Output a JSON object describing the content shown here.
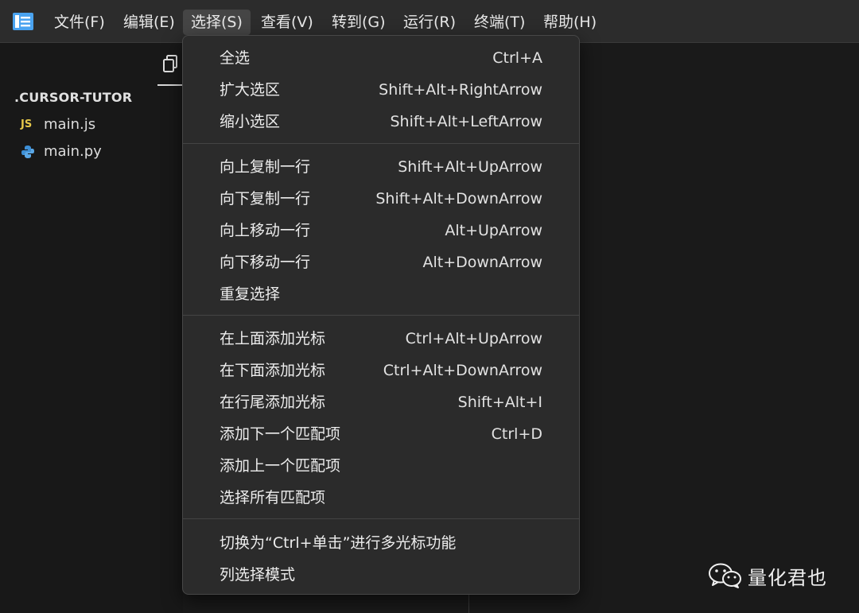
{
  "menubar": {
    "items": [
      {
        "label": "文件(F)"
      },
      {
        "label": "编辑(E)"
      },
      {
        "label": "选择(S)"
      },
      {
        "label": "查看(V)"
      },
      {
        "label": "转到(G)"
      },
      {
        "label": "运行(R)"
      },
      {
        "label": "终端(T)"
      },
      {
        "label": "帮助(H)"
      }
    ],
    "active_index": 2
  },
  "sidebar": {
    "folder_title": ".CURSOR-TUTOR",
    "files": [
      {
        "name": "main.js",
        "icon": "js-file-icon",
        "icon_text": "JS"
      },
      {
        "name": "main.py",
        "icon": "python-file-icon"
      }
    ]
  },
  "dropdown": {
    "items": [
      {
        "label": "全选",
        "shortcut": "Ctrl+A"
      },
      {
        "label": "扩大选区",
        "shortcut": "Shift+Alt+RightArrow"
      },
      {
        "label": "缩小选区",
        "shortcut": "Shift+Alt+LeftArrow"
      },
      {
        "label": "向上复制一行",
        "shortcut": "Shift+Alt+UpArrow"
      },
      {
        "label": "向下复制一行",
        "shortcut": "Shift+Alt+DownArrow"
      },
      {
        "label": "向上移动一行",
        "shortcut": "Alt+UpArrow"
      },
      {
        "label": "向下移动一行",
        "shortcut": "Alt+DownArrow"
      },
      {
        "label": "重复选择",
        "shortcut": ""
      },
      {
        "label": "在上面添加光标",
        "shortcut": "Ctrl+Alt+UpArrow"
      },
      {
        "label": "在下面添加光标",
        "shortcut": "Ctrl+Alt+DownArrow"
      },
      {
        "label": "在行尾添加光标",
        "shortcut": "Shift+Alt+I"
      },
      {
        "label": "添加下一个匹配项",
        "shortcut": "Ctrl+D"
      },
      {
        "label": "添加上一个匹配项",
        "shortcut": ""
      },
      {
        "label": "选择所有匹配项",
        "shortcut": ""
      },
      {
        "label": "切换为“Ctrl+单击”进行多光标功能",
        "shortcut": ""
      },
      {
        "label": "列选择模式",
        "shortcut": ""
      }
    ]
  },
  "watermark": {
    "text": "量化君也",
    "icon": "wechat-icon"
  },
  "colors": {
    "menubar_bg": "#2c2c2c",
    "dropdown_bg": "#2b2b2b",
    "sidebar_bg": "#181818",
    "logo_blue": "#4aa3f0",
    "js_yellow": "#e6c84a",
    "python_blue": "#3d8fd6"
  }
}
